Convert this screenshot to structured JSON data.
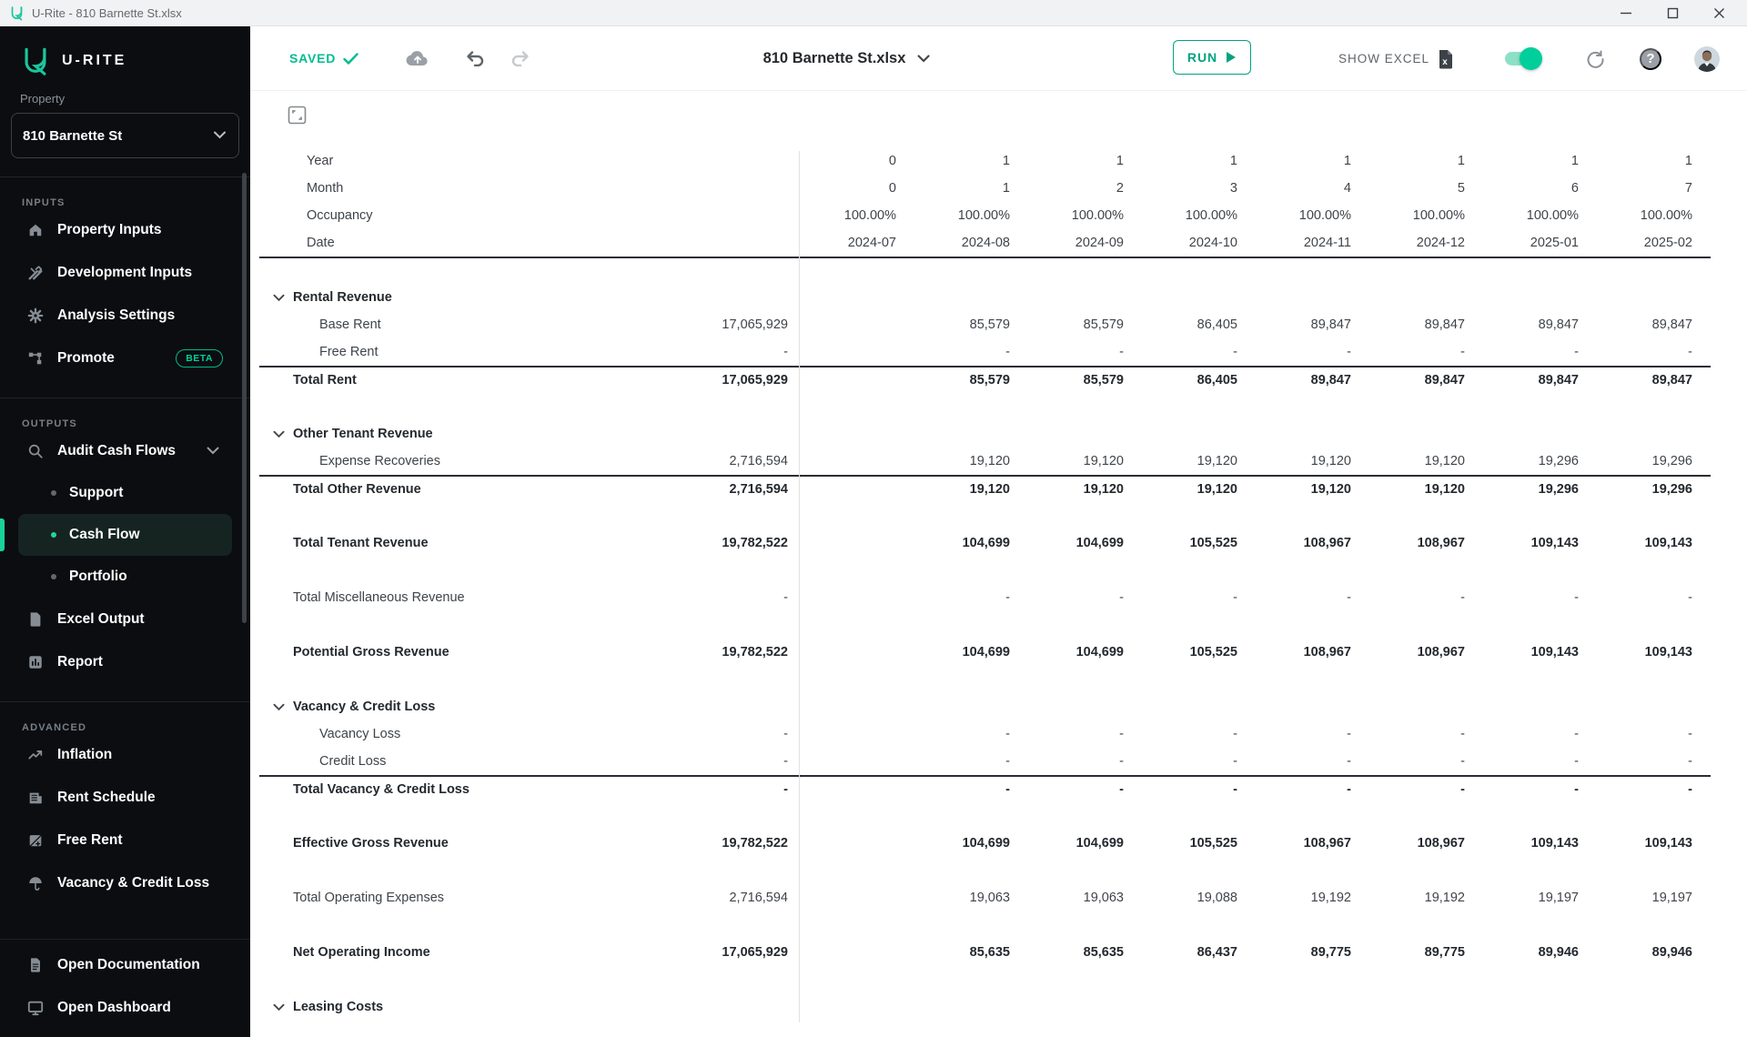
{
  "colors": {
    "accent": "#00bd90",
    "toggle_on": "#00cf9b",
    "run_teal": "#00a37f",
    "sidebar_bg": "#0b0d11",
    "selected_item_bg": "#152420",
    "bullet_teal": "#27d49e"
  },
  "titlebar": {
    "title": "U-Rite - 810 Barnette St.xlsx"
  },
  "window_controls": {
    "minimize": "minimize",
    "maximize": "maximize",
    "close": "close"
  },
  "brand": {
    "name": "U-RITE",
    "logo_icon": "urite-logo-icon"
  },
  "sidebar": {
    "property_label": "Property",
    "property_value": "810 Barnette St",
    "sections": [
      {
        "heading": "INPUTS",
        "items": [
          {
            "label": "Property Inputs",
            "icon": "home-icon"
          },
          {
            "label": "Development Inputs",
            "icon": "tools-icon"
          },
          {
            "label": "Analysis Settings",
            "icon": "gear-icon"
          },
          {
            "label": "Promote",
            "icon": "sitemap-icon",
            "badge": "BETA"
          }
        ]
      },
      {
        "heading": "OUTPUTS",
        "items": [
          {
            "label": "Audit Cash Flows",
            "icon": "search-icon",
            "expanded": true,
            "children": [
              {
                "label": "Support",
                "selected": false
              },
              {
                "label": "Cash Flow",
                "selected": true
              },
              {
                "label": "Portfolio",
                "selected": false
              }
            ]
          },
          {
            "label": "Excel Output",
            "icon": "excel-file-icon"
          },
          {
            "label": "Report",
            "icon": "report-chart-icon"
          }
        ]
      },
      {
        "heading": "ADVANCED",
        "items": [
          {
            "label": "Inflation",
            "icon": "trending-up-icon"
          },
          {
            "label": "Rent Schedule",
            "icon": "building-icon"
          },
          {
            "label": "Free Rent",
            "icon": "calendar-plus-icon"
          },
          {
            "label": "Vacancy & Credit Loss",
            "icon": "umbrella-icon",
            "clipped": true
          }
        ]
      }
    ],
    "footer_items": [
      {
        "label": "Open Documentation",
        "icon": "document-icon"
      },
      {
        "label": "Open Dashboard",
        "icon": "monitor-icon"
      }
    ]
  },
  "toolbar": {
    "saved_label": "SAVED",
    "saved_check_icon": "check-icon",
    "cloud_icon": "cloud-upload-icon",
    "undo_icon": "undo-icon",
    "redo_icon": "redo-icon",
    "workbook_title": "810 Barnette St.xlsx",
    "run_label": "RUN",
    "run_play_icon": "play-icon",
    "show_excel_label": "SHOW EXCEL",
    "excel_icon": "excel-file-icon",
    "toggle_state": "on",
    "sync_icon": "sync-icon",
    "help_label": "?",
    "avatar": "user-avatar"
  },
  "table": {
    "expand_icon": "expand-icon",
    "header_rows": [
      {
        "label": "Year",
        "values": [
          "0",
          "1",
          "1",
          "1",
          "1",
          "1",
          "1",
          "1"
        ]
      },
      {
        "label": "Month",
        "values": [
          "0",
          "1",
          "2",
          "3",
          "4",
          "5",
          "6",
          "7"
        ]
      },
      {
        "label": "Occupancy",
        "values": [
          "100.00%",
          "100.00%",
          "100.00%",
          "100.00%",
          "100.00%",
          "100.00%",
          "100.00%",
          "100.00%"
        ]
      },
      {
        "label": "Date",
        "values": [
          "2024-07",
          "2024-08",
          "2024-09",
          "2024-10",
          "2024-11",
          "2024-12",
          "2025-01",
          "2025-02"
        ]
      }
    ],
    "rows": [
      {
        "type": "section",
        "label": "Rental Revenue"
      },
      {
        "type": "item",
        "label": "Base Rent",
        "total": "17,065,929",
        "values": [
          "",
          "85,579",
          "85,579",
          "86,405",
          "89,847",
          "89,847",
          "89,847",
          "89,847"
        ]
      },
      {
        "type": "item",
        "label": "Free Rent",
        "total": "-",
        "values": [
          "",
          "-",
          "-",
          "-",
          "-",
          "-",
          "-",
          "-"
        ]
      },
      {
        "type": "total",
        "label": "Total Rent",
        "total": "17,065,929",
        "values": [
          "",
          "85,579",
          "85,579",
          "86,405",
          "89,847",
          "89,847",
          "89,847",
          "89,847"
        ]
      },
      {
        "type": "section",
        "label": "Other Tenant Revenue"
      },
      {
        "type": "item",
        "label": "Expense Recoveries",
        "total": "2,716,594",
        "values": [
          "",
          "19,120",
          "19,120",
          "19,120",
          "19,120",
          "19,120",
          "19,296",
          "19,296"
        ]
      },
      {
        "type": "total",
        "label": "Total Other Revenue",
        "total": "2,716,594",
        "values": [
          "",
          "19,120",
          "19,120",
          "19,120",
          "19,120",
          "19,120",
          "19,296",
          "19,296"
        ]
      },
      {
        "type": "grand",
        "label": "Total Tenant Revenue",
        "total": "19,782,522",
        "values": [
          "",
          "104,699",
          "104,699",
          "105,525",
          "108,967",
          "108,967",
          "109,143",
          "109,143"
        ]
      },
      {
        "type": "plain",
        "label": "Total Miscellaneous Revenue",
        "total": "-",
        "values": [
          "",
          "-",
          "-",
          "-",
          "-",
          "-",
          "-",
          "-"
        ]
      },
      {
        "type": "grand",
        "label": "Potential Gross Revenue",
        "total": "19,782,522",
        "values": [
          "",
          "104,699",
          "104,699",
          "105,525",
          "108,967",
          "108,967",
          "109,143",
          "109,143"
        ]
      },
      {
        "type": "section",
        "label": "Vacancy & Credit Loss"
      },
      {
        "type": "item",
        "label": "Vacancy Loss",
        "total": "-",
        "values": [
          "",
          "-",
          "-",
          "-",
          "-",
          "-",
          "-",
          "-"
        ]
      },
      {
        "type": "item",
        "label": "Credit Loss",
        "total": "-",
        "values": [
          "",
          "-",
          "-",
          "-",
          "-",
          "-",
          "-",
          "-"
        ]
      },
      {
        "type": "total",
        "label": "Total Vacancy & Credit Loss",
        "total": "-",
        "values": [
          "",
          "-",
          "-",
          "-",
          "-",
          "-",
          "-",
          "-"
        ]
      },
      {
        "type": "grand",
        "label": "Effective Gross Revenue",
        "total": "19,782,522",
        "values": [
          "",
          "104,699",
          "104,699",
          "105,525",
          "108,967",
          "108,967",
          "109,143",
          "109,143"
        ]
      },
      {
        "type": "plain",
        "label": "Total Operating Expenses",
        "total": "2,716,594",
        "values": [
          "",
          "19,063",
          "19,063",
          "19,088",
          "19,192",
          "19,192",
          "19,197",
          "19,197"
        ]
      },
      {
        "type": "grand",
        "label": "Net Operating Income",
        "total": "17,065,929",
        "values": [
          "",
          "85,635",
          "85,635",
          "86,437",
          "89,775",
          "89,775",
          "89,946",
          "89,946"
        ]
      },
      {
        "type": "section",
        "label": "Leasing Costs"
      }
    ]
  }
}
